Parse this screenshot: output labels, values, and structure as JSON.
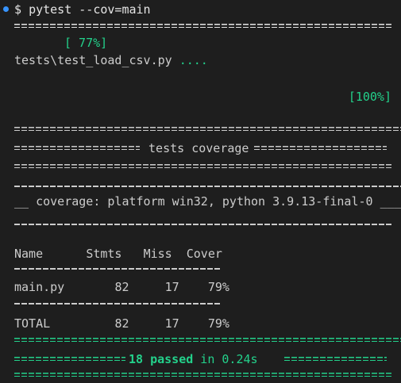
{
  "prompt": {
    "symbol": "$",
    "command": "pytest --cov=main"
  },
  "progress": {
    "percent_mid": "[ 77%]",
    "test_file": "tests\\test_load_csv.py",
    "dots": "....",
    "percent_end": "[100%]"
  },
  "coverage": {
    "section_title": " tests coverage ",
    "platform_line": " coverage: platform win32, python 3.9.13-final-0 ",
    "table": {
      "headers": [
        "Name",
        "Stmts",
        "Miss",
        "Cover"
      ],
      "rows": [
        [
          "main.py",
          "82",
          "17",
          "79%"
        ]
      ],
      "total": [
        "TOTAL",
        "82",
        "17",
        "79%"
      ]
    }
  },
  "summary": {
    "passed": "18 passed",
    "duration": " in 0.24s "
  },
  "colors": {
    "background": "#1e1e1e",
    "text": "#cccccc",
    "green": "#23d18b",
    "prompt_dot": "#3794ff"
  }
}
